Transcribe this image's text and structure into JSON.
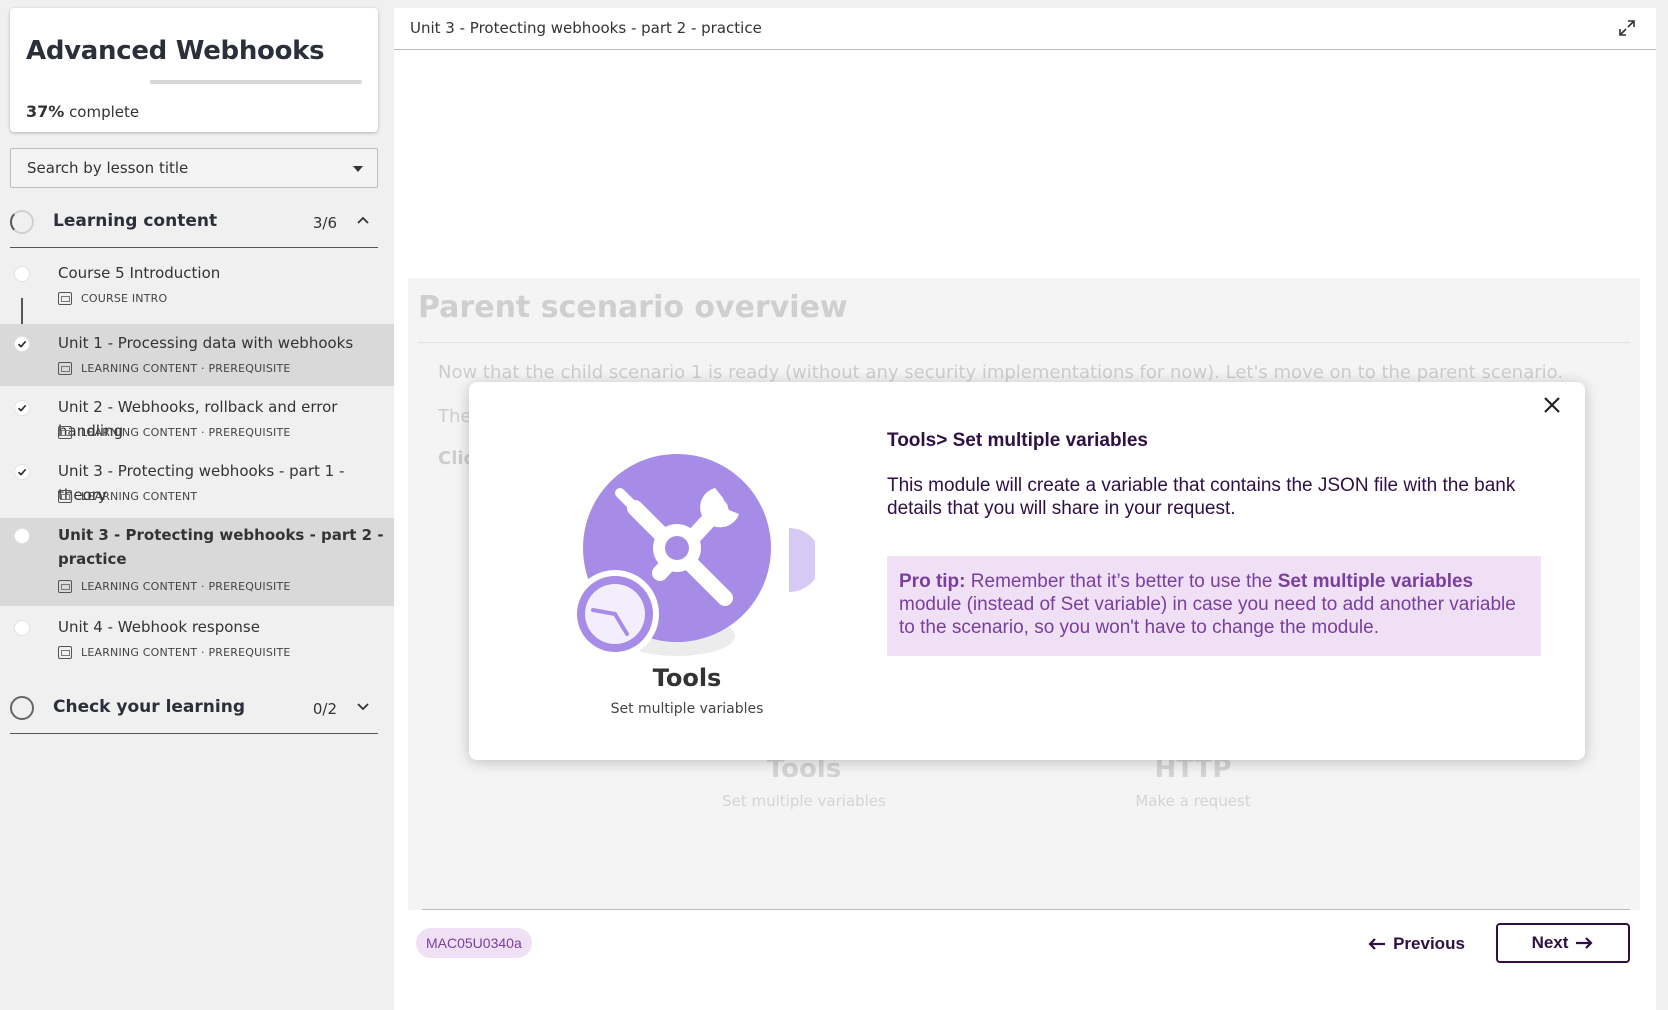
{
  "course": {
    "title": "Advanced Webhooks",
    "progress_percent": "37%",
    "progress_suffix": " complete",
    "progress_value": 37
  },
  "search": {
    "placeholder": "Search by lesson title"
  },
  "sections": [
    {
      "label": "Learning content",
      "count": "3/6",
      "expanded": true
    },
    {
      "label": "Check your learning",
      "count": "0/2",
      "expanded": false
    }
  ],
  "lessons": [
    {
      "title": "Course 5 Introduction",
      "meta": "COURSE INTRO",
      "done": false
    },
    {
      "title": "Unit 1 - Processing data with webhooks",
      "meta": "LEARNING CONTENT · PREREQUISITE",
      "done": true
    },
    {
      "title": "Unit 2 - Webhooks, rollback and error handling",
      "meta": "LEARNING CONTENT · PREREQUISITE",
      "done": true
    },
    {
      "title": "Unit 3 - Protecting webhooks - part 1 - theory",
      "meta": "LEARNING CONTENT",
      "done": true
    },
    {
      "title": "Unit 3 - Protecting webhooks - part 2 - practice",
      "title_line1": "Unit 3 - Protecting webhooks - part 2 -",
      "title_line2": "practice",
      "meta": "LEARNING CONTENT · PREREQUISITE",
      "done": false,
      "current": true
    },
    {
      "title": "Unit 4 - Webhook response",
      "meta": "LEARNING CONTENT · PREREQUISITE",
      "done": false
    }
  ],
  "main": {
    "header_title": "Unit 3 - Protecting webhooks - part 2 - practice",
    "bg_heading": "Parent scenario overview",
    "bg_line1": "Now that the child scenario 1 is ready (without any security implementations for now). Let's move on to the parent scenario.",
    "bg_line2": "The",
    "bg_line3": "Clic",
    "bg_captions": [
      {
        "title": "Tools",
        "sub": "Set multiple variables"
      },
      {
        "title": "HTTP",
        "sub": "Make a request"
      }
    ],
    "code_badge": "MAC05U0340a",
    "prev_label": "Previous",
    "next_label": "Next"
  },
  "modal": {
    "tool_name": "Tools",
    "tool_sub": "Set multiple variables",
    "title": "Tools> Set multiple variables",
    "description": "This module will create a variable that contains the JSON file with the bank details that you will share in your request.",
    "tip_label": "Pro tip:",
    "tip_text1": " Remember that it’s better to use the ",
    "tip_bold": "Set multiple variables",
    "tip_text2": " module (instead of Set variable) in case you need to add another variable to the scenario, so you won't have to change the module."
  },
  "colors": {
    "accent_purple": "#a68ce6",
    "brand_dark": "#2e1045",
    "tip_bg": "#efe0f6",
    "tip_text": "#7a3e9d"
  }
}
